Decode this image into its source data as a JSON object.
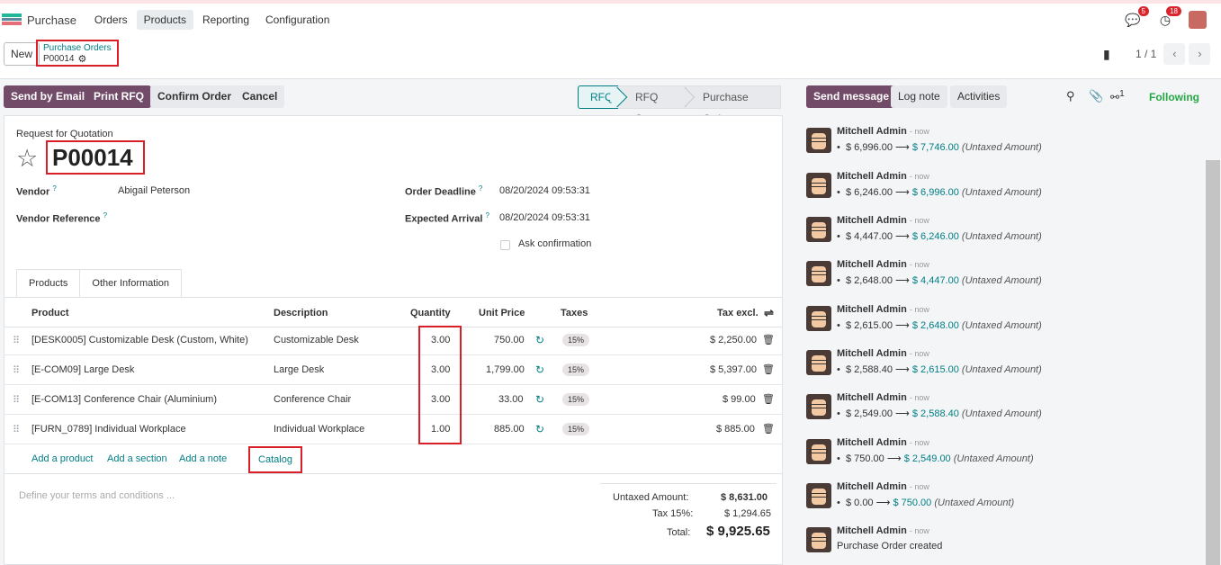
{
  "navbar": {
    "app_name": "Purchase",
    "menu": [
      "Orders",
      "Products",
      "Reporting",
      "Configuration"
    ],
    "active_menu": "Products",
    "messages_count": "5",
    "activities_count": "18",
    "brand_colors": [
      "#017e84",
      "#714b67",
      "#d9262e"
    ]
  },
  "control_panel": {
    "new_label": "New",
    "breadcrumb_parent": "Purchase Orders",
    "breadcrumb_current": "P00014",
    "pager": "1 / 1"
  },
  "status": {
    "buttons": [
      "Send by Email",
      "Print RFQ",
      "Confirm Order",
      "Cancel"
    ],
    "stages": [
      "RFQ",
      "RFQ Sent",
      "Purchase Order"
    ],
    "active_stage": "RFQ"
  },
  "form": {
    "doc_type": "Request for Quotation",
    "name": "P00014",
    "vendor_label": "Vendor",
    "vendor_value": "Abigail Peterson",
    "vendor_ref_label": "Vendor Reference",
    "deadline_label": "Order Deadline",
    "deadline_value": "08/20/2024 09:53:31",
    "arrival_label": "Expected Arrival",
    "arrival_value": "08/20/2024 09:53:31",
    "ask_confirmation": "Ask confirmation"
  },
  "tabs": [
    "Products",
    "Other Information"
  ],
  "table": {
    "headers": {
      "product": "Product",
      "description": "Description",
      "quantity": "Quantity",
      "unit_price": "Unit Price",
      "taxes": "Taxes",
      "tax_excl": "Tax excl."
    },
    "rows": [
      {
        "product": "[DESK0005] Customizable Desk (Custom, White)",
        "description": "Customizable Desk",
        "quantity": "3.00",
        "unit_price": "750.00",
        "tax": "15%",
        "subtotal": "$ 2,250.00"
      },
      {
        "product": "[E-COM09] Large Desk",
        "description": "Large Desk",
        "quantity": "3.00",
        "unit_price": "1,799.00",
        "tax": "15%",
        "subtotal": "$ 5,397.00"
      },
      {
        "product": "[E-COM13] Conference Chair (Aluminium)",
        "description": "Conference Chair",
        "quantity": "3.00",
        "unit_price": "33.00",
        "tax": "15%",
        "subtotal": "$ 99.00"
      },
      {
        "product": "[FURN_0789] Individual Workplace",
        "description": "Individual Workplace",
        "quantity": "1.00",
        "unit_price": "885.00",
        "tax": "15%",
        "subtotal": "$ 885.00"
      }
    ],
    "add_product": "Add a product",
    "add_section": "Add a section",
    "add_note": "Add a note",
    "catalog": "Catalog"
  },
  "terms_placeholder": "Define your terms and conditions ...",
  "totals": {
    "untaxed_label": "Untaxed Amount:",
    "untaxed_value": "$ 8,631.00",
    "tax_label": "Tax 15%:",
    "tax_value": "$ 1,294.65",
    "total_label": "Total:",
    "total_value": "$ 9,925.65"
  },
  "chatter": {
    "send_message": "Send message",
    "log_note": "Log note",
    "activities": "Activities",
    "followers_count": "1",
    "following": "Following",
    "messages": [
      {
        "author": "Mitchell Admin",
        "time": "now",
        "old": "$ 6,996.00",
        "new": "$ 7,746.00",
        "note": "(Untaxed Amount)"
      },
      {
        "author": "Mitchell Admin",
        "time": "now",
        "old": "$ 6,246.00",
        "new": "$ 6,996.00",
        "note": "(Untaxed Amount)"
      },
      {
        "author": "Mitchell Admin",
        "time": "now",
        "old": "$ 4,447.00",
        "new": "$ 6,246.00",
        "note": "(Untaxed Amount)"
      },
      {
        "author": "Mitchell Admin",
        "time": "now",
        "old": "$ 2,648.00",
        "new": "$ 4,447.00",
        "note": "(Untaxed Amount)"
      },
      {
        "author": "Mitchell Admin",
        "time": "now",
        "old": "$ 2,615.00",
        "new": "$ 2,648.00",
        "note": "(Untaxed Amount)"
      },
      {
        "author": "Mitchell Admin",
        "time": "now",
        "old": "$ 2,588.40",
        "new": "$ 2,615.00",
        "note": "(Untaxed Amount)"
      },
      {
        "author": "Mitchell Admin",
        "time": "now",
        "old": "$ 2,549.00",
        "new": "$ 2,588.40",
        "note": "(Untaxed Amount)"
      },
      {
        "author": "Mitchell Admin",
        "time": "now",
        "old": "$ 750.00",
        "new": "$ 2,549.00",
        "note": "(Untaxed Amount)"
      },
      {
        "author": "Mitchell Admin",
        "time": "now",
        "old": "$ 0.00",
        "new": "$ 750.00",
        "note": "(Untaxed Amount)"
      },
      {
        "author": "Mitchell Admin",
        "time": "now",
        "text": "Purchase Order created"
      }
    ]
  }
}
